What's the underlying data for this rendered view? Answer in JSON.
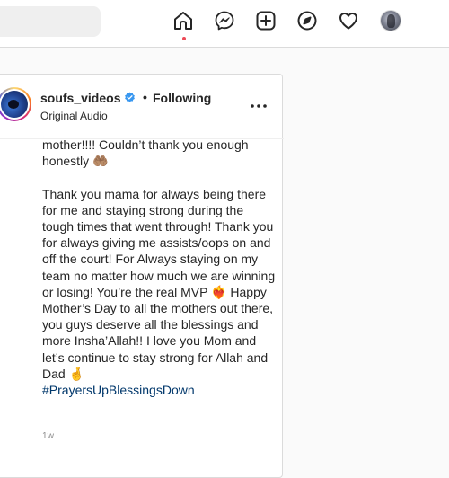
{
  "nav": {
    "search_placeholder": "",
    "icons": [
      "home-icon",
      "messenger-icon",
      "new-post-icon",
      "explore-icon",
      "activity-heart-icon",
      "profile-avatar"
    ],
    "active": "home",
    "notification_dot_color": "#ed4956"
  },
  "post": {
    "username": "soufs_videos",
    "verified": true,
    "separator": "•",
    "follow_status": "Following",
    "audio_label": "Original Audio",
    "more_icon": "more-options-icon",
    "caption": {
      "line1": "mother!!!! Couldn’t thank you enough",
      "line2": "honestly 🤲🏽",
      "paragraph2": "Thank you mama for always being\nthere for me and staying strong during\nthe tough times that went through!\nThank you for always giving me\nassists/oops on and off the court! For\nAlways staying on my team no matter\nhow much we are winning or losing!\nYou’re the real MVP ❤️‍🔥\nHappy Mother’s Day to all the mothers\nout there, you guys deserve all the\nblessings and more Insha’Allah!! I love\nyou Mom and let’s continue to stay\nstrong for Allah and Dad 🤞",
      "hashtag": "#PrayersUpBlessingsDown"
    },
    "timestamp": "1w"
  },
  "colors": {
    "link": "#00376b",
    "verified": "#3897f0",
    "border": "#dbdbdb",
    "muted": "#8e8e8e"
  }
}
